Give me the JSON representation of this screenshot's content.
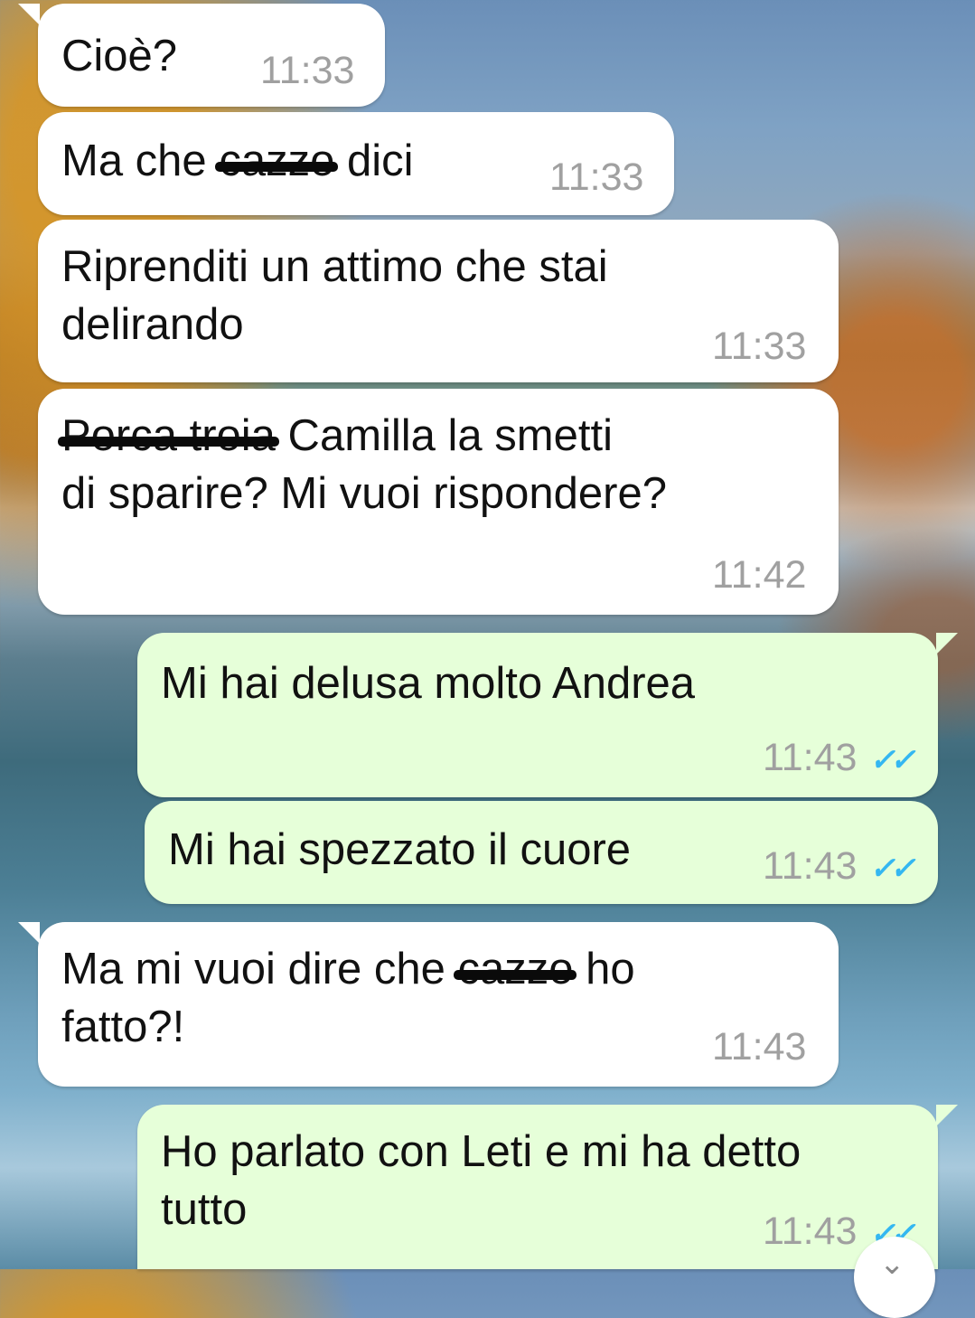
{
  "messages": [
    {
      "text_before": "Cioè?",
      "time": "11:33"
    },
    {
      "text_before": "Ma che ",
      "struck": "cazzo",
      "text_after": " dici",
      "time": "11:33"
    },
    {
      "line1": "Riprenditi un attimo che stai",
      "line2": "delirando",
      "time": "11:33"
    },
    {
      "struck": "Porca troia",
      "line1_after": " Camilla la smetti",
      "line2": "di sparire? Mi vuoi rispondere?",
      "time": "11:42"
    },
    {
      "text_before": "Mi hai delusa molto Andrea",
      "time": "11:43",
      "status": "read"
    },
    {
      "text_before": "Mi hai spezzato il cuore",
      "time": "11:43",
      "status": "read"
    },
    {
      "line1_before": "Ma mi vuoi dire che ",
      "struck": "cazzo",
      "line1_after": " ho",
      "line2": "fatto?!",
      "time": "11:43"
    },
    {
      "line1": "Ho parlato con Leti e mi ha detto",
      "line2": "tutto",
      "time": "11:43",
      "status": "read"
    }
  ],
  "icons": {
    "read_receipt": "double-check-icon",
    "scroll_down": "chevron-down-icon"
  },
  "colors": {
    "incoming": "#ffffff",
    "outgoing": "#e6ffd9",
    "read_tick": "#34b7f1",
    "timestamp": "#a0a0a0"
  }
}
